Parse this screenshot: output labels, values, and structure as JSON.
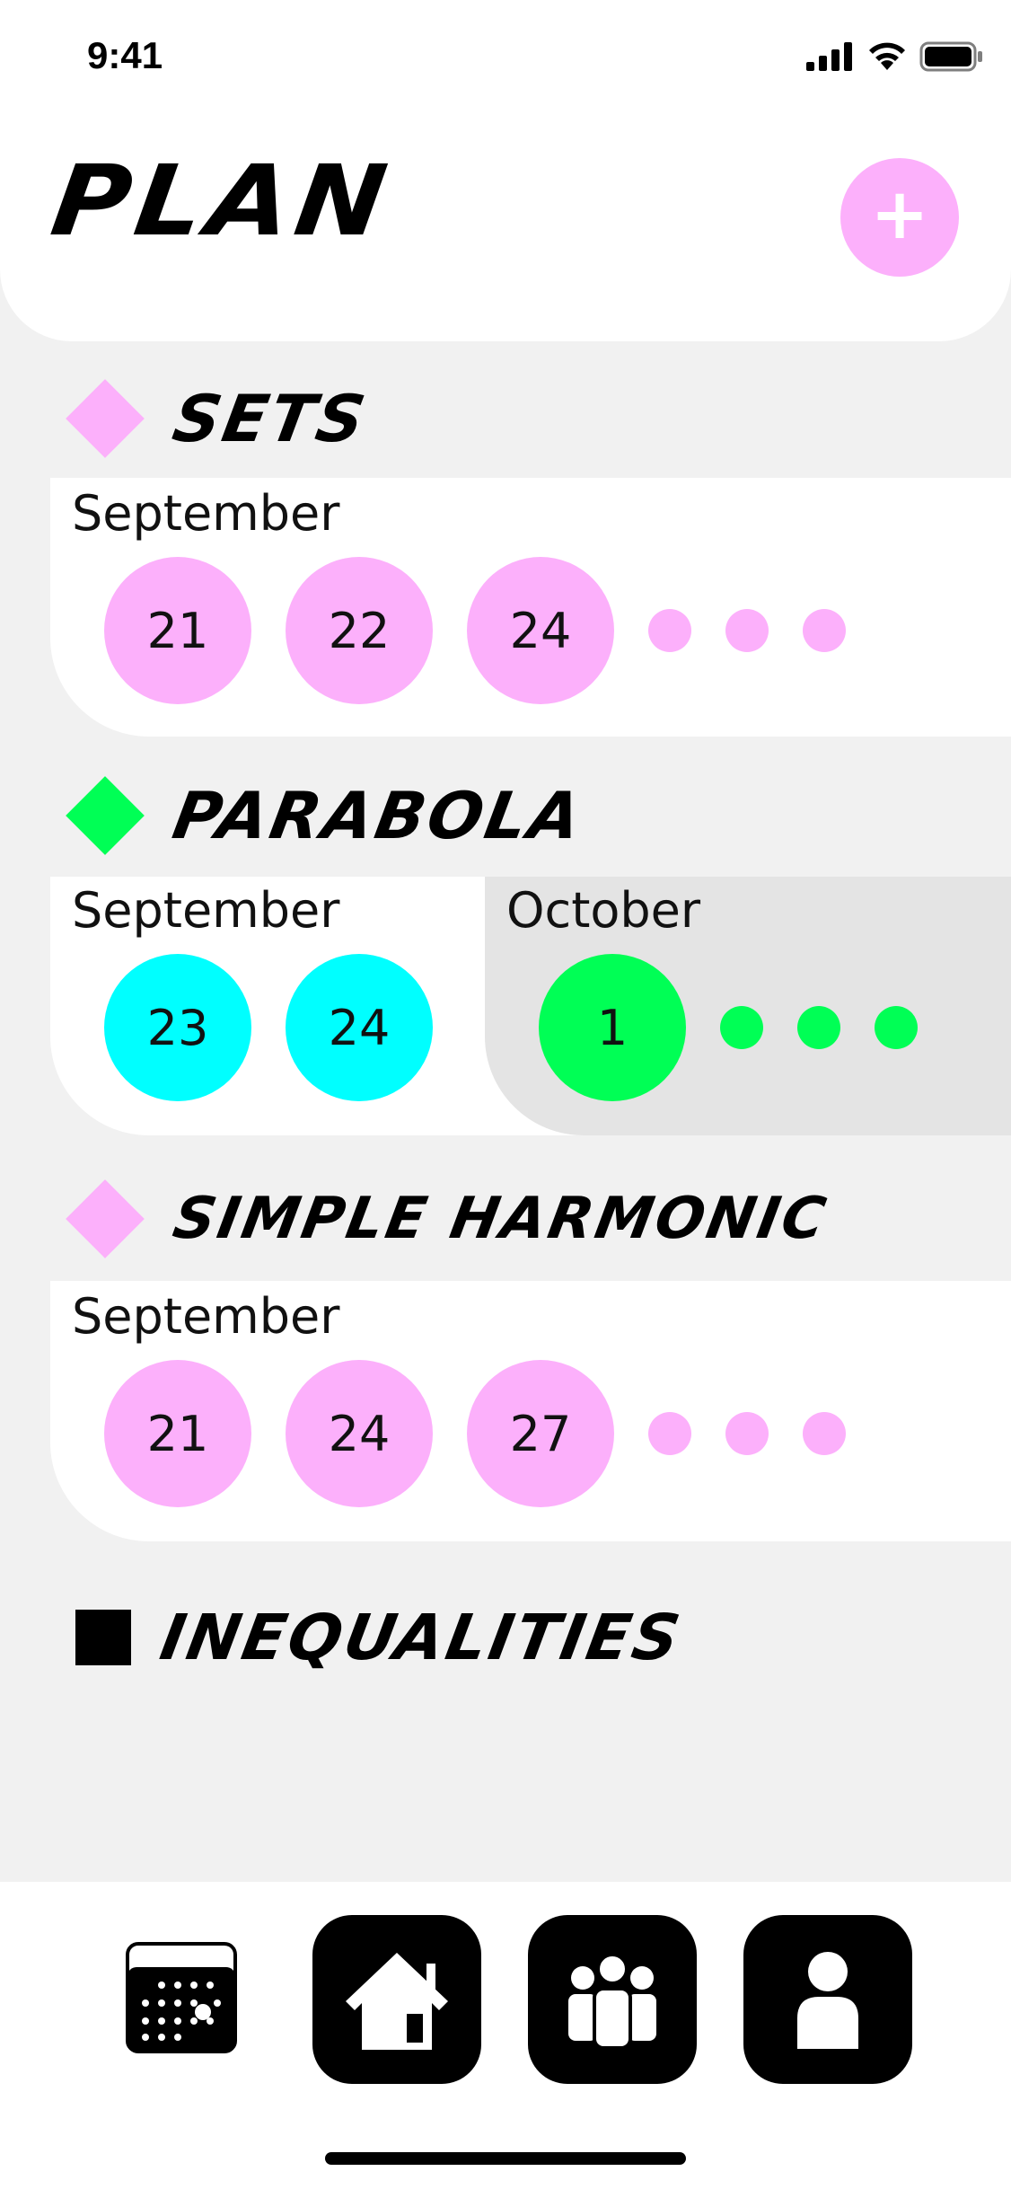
{
  "status_bar": {
    "time": "9:41"
  },
  "header": {
    "title": "PLAN",
    "add_label": "+"
  },
  "colors": {
    "pink": "#fcb0fb",
    "cyan": "#00ffff",
    "green": "#00ff55",
    "black": "#000000"
  },
  "sections": [
    {
      "title": "SETS",
      "marker": "diamond",
      "color": "#fcb0fb",
      "groups": [
        {
          "month": "September",
          "days": [
            "21",
            "22",
            "24"
          ],
          "more": true,
          "color": "#fcb0fb"
        }
      ]
    },
    {
      "title": "PARABOLA",
      "marker": "diamond",
      "color": "#00ff55",
      "groups": [
        {
          "month": "September",
          "days": [
            "23",
            "24"
          ],
          "more": false,
          "color": "#00ffff"
        },
        {
          "month": "October",
          "days": [
            "1"
          ],
          "more": true,
          "color": "#00ff55"
        }
      ]
    },
    {
      "title": "SIMPLE HARMONIC",
      "marker": "diamond",
      "color": "#fcb0fb",
      "groups": [
        {
          "month": "September",
          "days": [
            "21",
            "24",
            "27"
          ],
          "more": true,
          "color": "#fcb0fb"
        }
      ]
    },
    {
      "title": "INEQUALITIES",
      "marker": "square",
      "color": "#000000",
      "groups": []
    }
  ],
  "tab_bar": {
    "items": [
      {
        "name": "calendar",
        "icon": "calendar-icon",
        "active": true
      },
      {
        "name": "home",
        "icon": "home-icon",
        "active": false
      },
      {
        "name": "groups",
        "icon": "group-icon",
        "active": false
      },
      {
        "name": "profile",
        "icon": "profile-icon",
        "active": false
      }
    ]
  }
}
